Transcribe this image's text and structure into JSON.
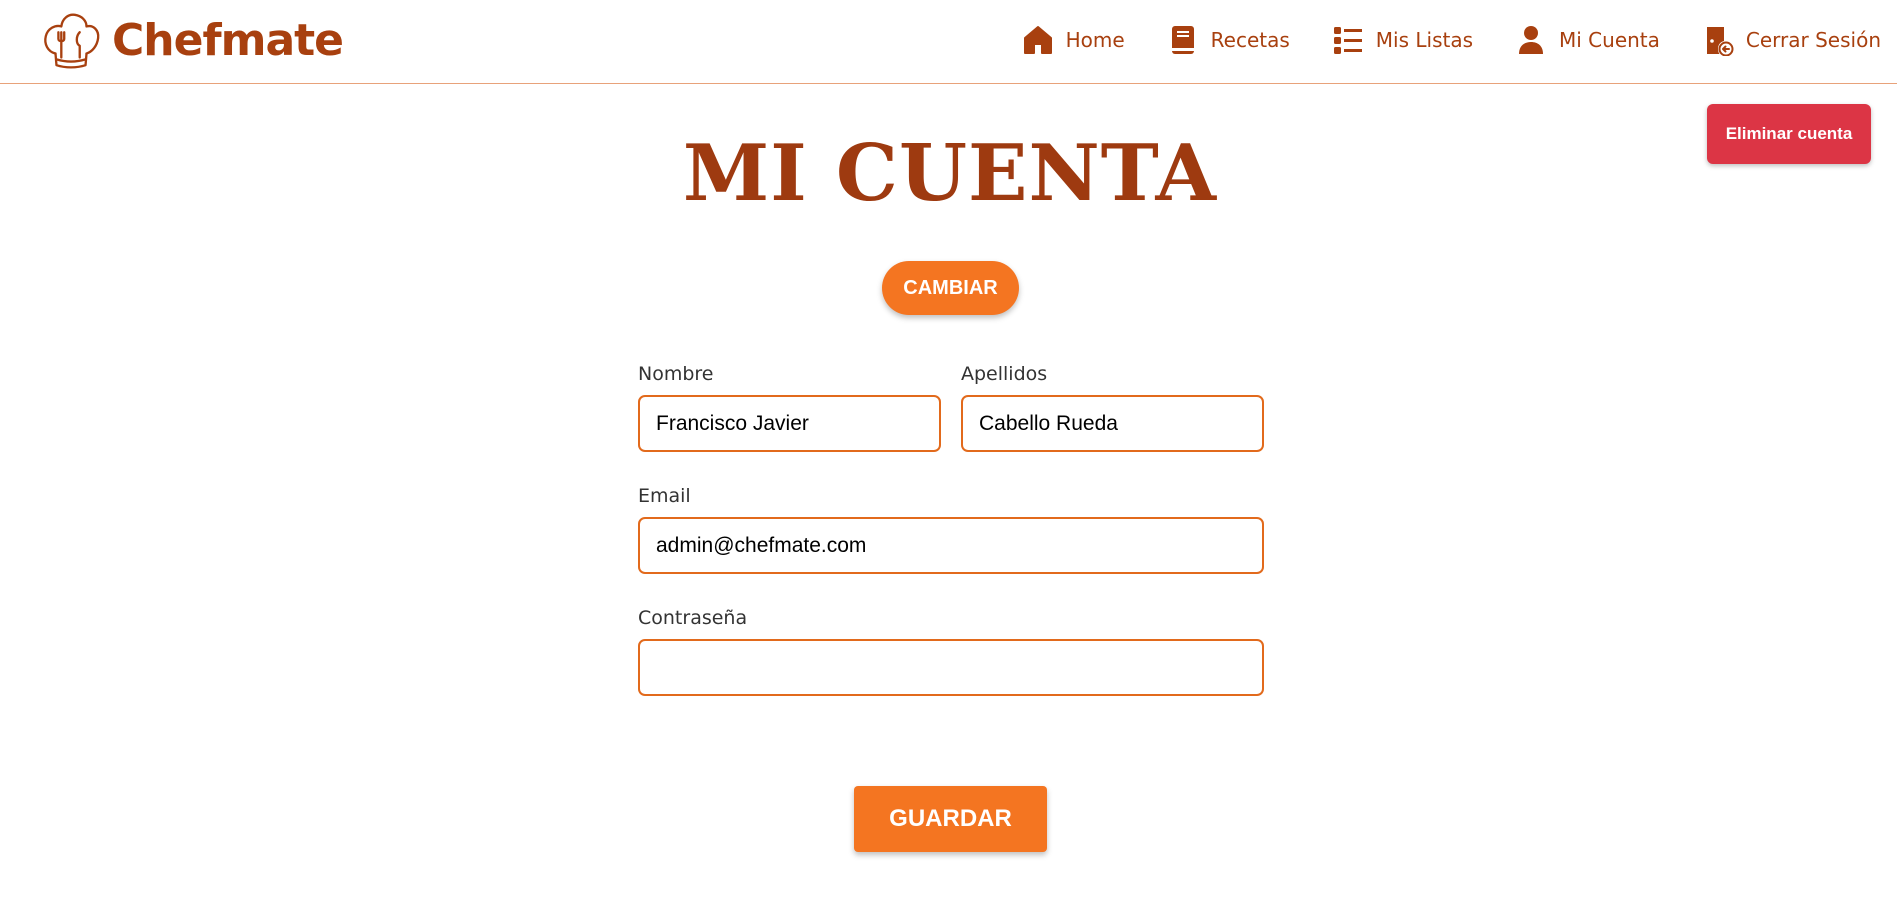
{
  "brand": {
    "name": "Chefmate",
    "logo_icon": "chef-hat-icon"
  },
  "nav": {
    "items": [
      {
        "label": "Home",
        "icon": "home-icon"
      },
      {
        "label": "Recetas",
        "icon": "book-icon"
      },
      {
        "label": "Mis Listas",
        "icon": "list-icon"
      },
      {
        "label": "Mi Cuenta",
        "icon": "user-icon"
      },
      {
        "label": "Cerrar Sesión",
        "icon": "logout-icon"
      }
    ]
  },
  "actions": {
    "delete_account": "Eliminar cuenta",
    "change": "CAMBIAR",
    "save": "GUARDAR"
  },
  "page": {
    "title": "MI CUENTA"
  },
  "form": {
    "nombre": {
      "label": "Nombre",
      "value": "Francisco Javier"
    },
    "apellidos": {
      "label": "Apellidos",
      "value": "Cabello Rueda"
    },
    "email": {
      "label": "Email",
      "value": "admin@chefmate.com"
    },
    "password": {
      "label": "Contraseña",
      "value": ""
    }
  },
  "colors": {
    "brand": "#a8400f",
    "title": "#9e3a10",
    "accent": "#f47521",
    "input_border": "#e26a1c",
    "danger": "#dc3545"
  }
}
